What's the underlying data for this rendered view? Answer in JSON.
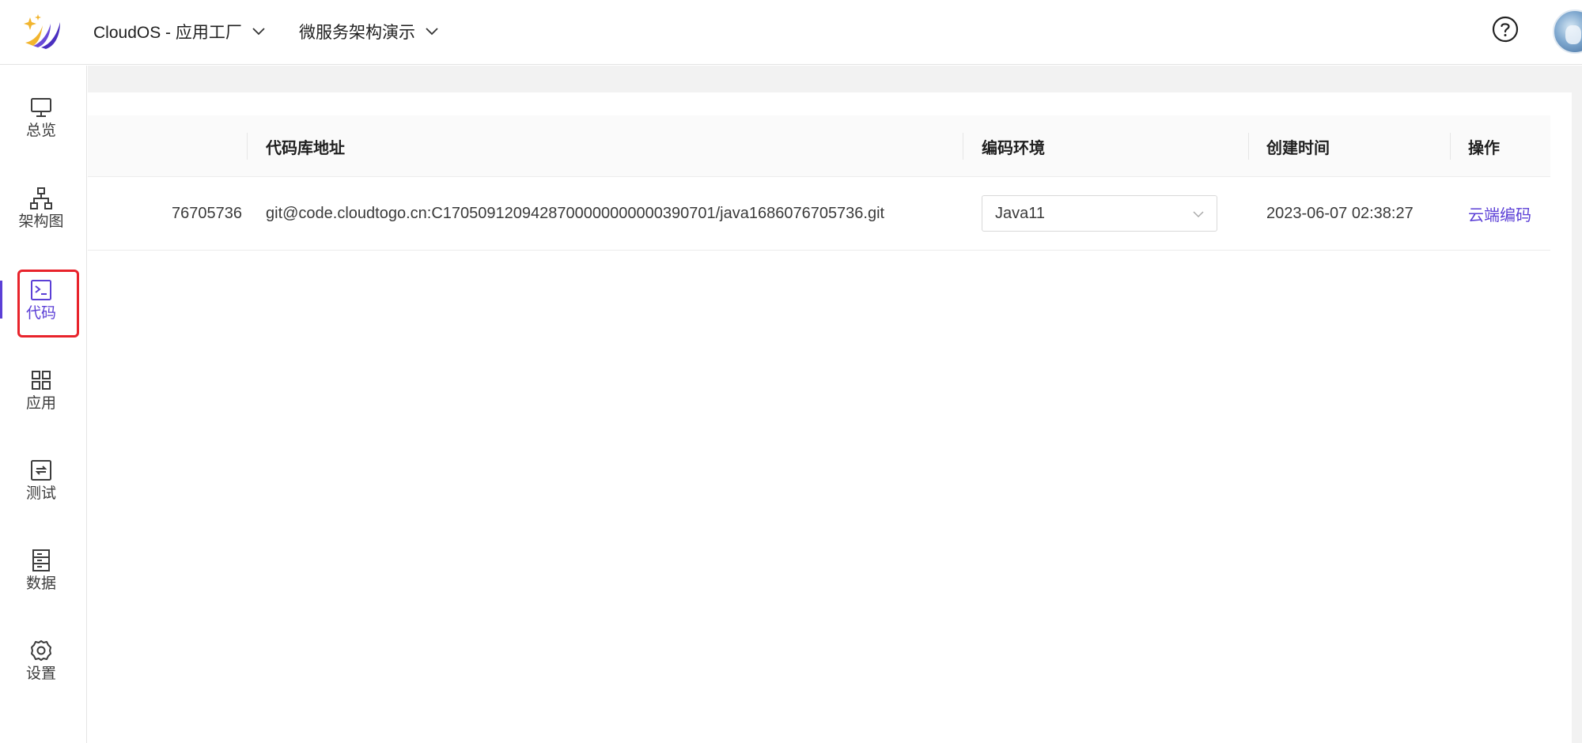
{
  "header": {
    "app_selector": "CloudOS - 应用工厂",
    "project_selector": "微服务架构演示"
  },
  "sidebar": {
    "items": [
      {
        "label": "总览",
        "icon": "monitor-icon"
      },
      {
        "label": "架构图",
        "icon": "architecture-icon"
      },
      {
        "label": "代码",
        "icon": "terminal-icon",
        "active": true
      },
      {
        "label": "应用",
        "icon": "grid-icon"
      },
      {
        "label": "测试",
        "icon": "refresh-icon"
      },
      {
        "label": "数据",
        "icon": "database-icon"
      },
      {
        "label": "设置",
        "icon": "gear-icon"
      }
    ]
  },
  "table": {
    "columns": [
      "代码库地址",
      "编码环境",
      "创建时间",
      "操作"
    ],
    "rows": [
      {
        "name_partial": "76705736",
        "repo_url": "git@code.cloudtogo.cn:C1705091209428700000000000390701/java1686076705736.git",
        "env": "Java11",
        "created": "2023-06-07 02:38:27",
        "action": "云端编码"
      }
    ]
  },
  "colors": {
    "accent": "#5b3fd6",
    "highlight": "#e8232b"
  }
}
